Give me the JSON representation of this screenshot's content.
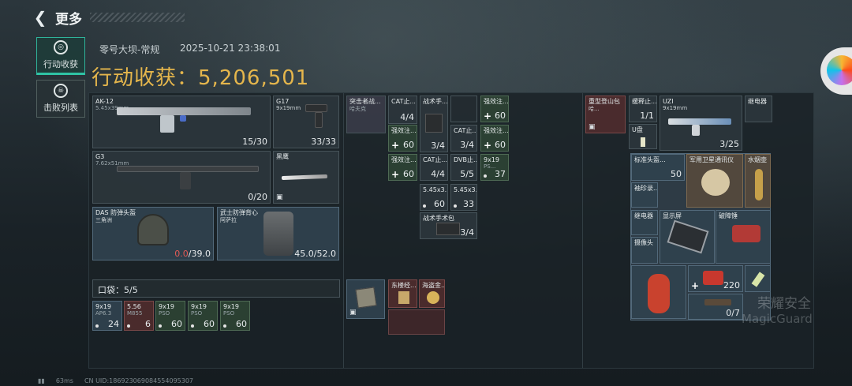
{
  "nav": {
    "title": "更多"
  },
  "side": {
    "tab1": "行动收获",
    "tab2": "击败列表"
  },
  "header": {
    "map": "零号大坝-常规",
    "time": "2025-10-21 23:38:01",
    "gain_label": "行动收获：",
    "gain_value": "5,206,501"
  },
  "loadout": {
    "ak": {
      "name": "AK-12",
      "cal": "5.45x39mm",
      "count": "15/30"
    },
    "g17": {
      "name": "G17",
      "cal": "9x19mm",
      "count": "33/33"
    },
    "g3": {
      "name": "G3",
      "cal": "7.62x51mm",
      "count": "0/20"
    },
    "heiying": {
      "name": "黑鹰"
    },
    "helmet": {
      "name": "DAS 防弹头盔",
      "sub": "三角洲",
      "dur_cur": "0.0",
      "dur_max": "/39.0"
    },
    "vest": {
      "name": "武士防弹背心",
      "sub": "阿萨拉",
      "dur": "45.0/52.0"
    },
    "pocket_label": "口袋：",
    "pocket_count": "5/5",
    "pocket": [
      {
        "name": "9x19",
        "sub": "AP6.3",
        "count": "24"
      },
      {
        "name": "5.56",
        "sub": "M855",
        "count": "6"
      },
      {
        "name": "9x19",
        "sub": "PSO",
        "count": "60"
      },
      {
        "name": "9x19",
        "sub": "PSO",
        "count": "60"
      },
      {
        "name": "9x19",
        "sub": "PSO",
        "count": "60"
      }
    ]
  },
  "chest": [
    {
      "name": "突击者战...",
      "sub": "哈夫克"
    },
    {
      "name": "CAT止...",
      "count": "4/4"
    },
    {
      "name": "战术手...",
      "count": "3/4"
    },
    {
      "name": "强效注...",
      "count": "60"
    },
    {
      "name": "强效注...",
      "count": "60"
    },
    {
      "name": "CAT止...",
      "count": "3/4"
    },
    {
      "name": "强效注...",
      "count": "60"
    },
    {
      "name": "强效注...",
      "count": "60"
    },
    {
      "name": "CAT止...",
      "count": "4/4"
    },
    {
      "name": "DVB止...",
      "count": "5/5"
    },
    {
      "name": "9x19",
      "sub": "PS...",
      "count": "37"
    },
    {
      "name": "5.45x3...",
      "count": "60"
    },
    {
      "name": "5.45x3...",
      "count": "33"
    },
    {
      "name": "战术手术包",
      "count": "3/4"
    },
    {
      "name": "东楼经..."
    },
    {
      "name": "海盗金..."
    }
  ],
  "backpack": {
    "rucksack": {
      "name": "重型登山包",
      "sub": "哈..."
    },
    "relay1": {
      "name": "继电器"
    },
    "uzi": {
      "name": "UZI",
      "cal": "9x19mm",
      "count": "3/25"
    },
    "items": [
      {
        "name": "缓释止...",
        "count": "1/1"
      },
      {
        "name": "U盘"
      },
      {
        "name": "标准头盔...",
        "count": "50"
      },
      {
        "name": "军用卫星通讯仪"
      },
      {
        "name": "水烟壶"
      },
      {
        "name": "袖珍录..."
      },
      {
        "name": "继电器"
      },
      {
        "name": "显示屏"
      },
      {
        "name": "破障锤"
      },
      {
        "name": "摄像头"
      },
      {
        "name": "220"
      },
      {
        "name": "0/7"
      }
    ]
  },
  "watermark": {
    "cn": "荣耀安全",
    "en": "MagicGuard"
  },
  "footer": {
    "ping": "63ms",
    "uid": "CN UID:18692306908455409530​7"
  }
}
